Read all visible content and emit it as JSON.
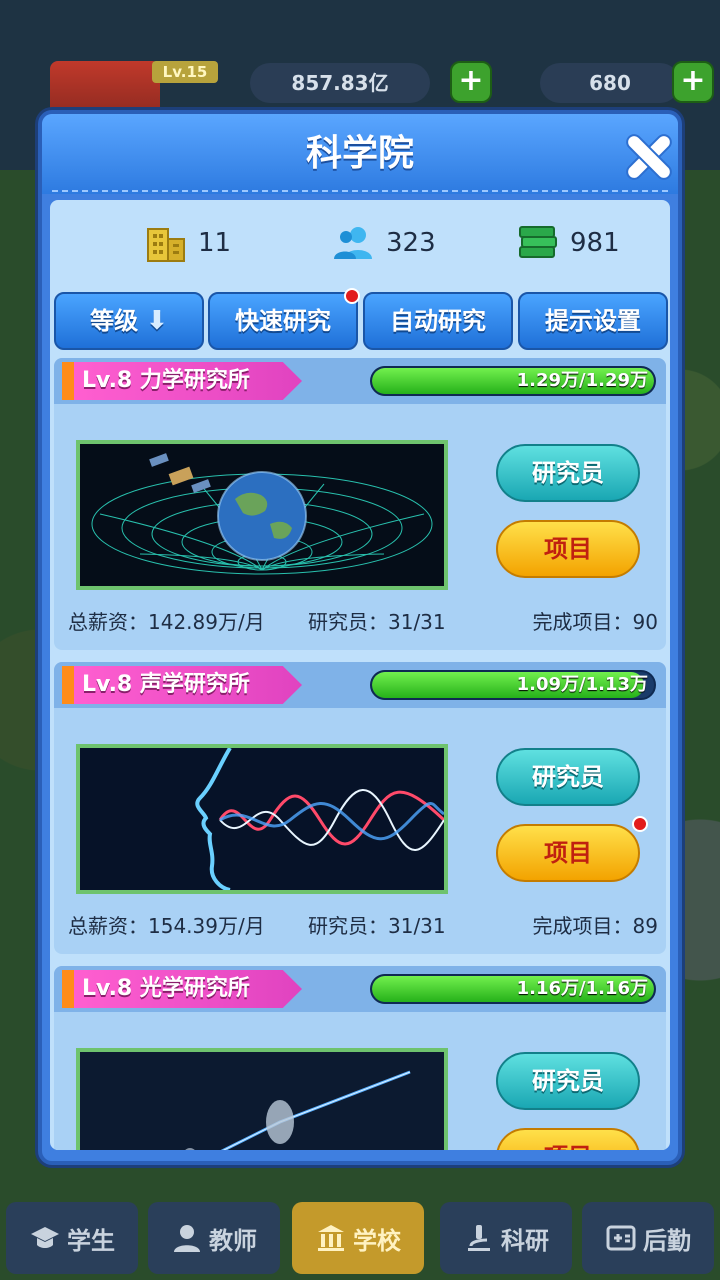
{
  "topbar": {
    "level": "Lv.15",
    "money": "857.83亿",
    "gems": "680",
    "plus": "+"
  },
  "dialog": {
    "title": "科学院",
    "stats": {
      "buildings": "11",
      "researchers": "323",
      "books": "981"
    },
    "tabs": [
      {
        "label": "等级"
      },
      {
        "label": "快速研究"
      },
      {
        "label": "自动研究"
      },
      {
        "label": "提示设置"
      }
    ],
    "tab_arrow": "⬇",
    "institutes": [
      {
        "level_name": "Lv.8 力学研究所",
        "progress_text": "1.29万/1.29万",
        "progress": 1.0,
        "researcher_btn": "研究员",
        "project_btn": "项目",
        "salary": "总薪资：142.89万/月",
        "staff": "研究员：31/31",
        "done": "完成项目：90"
      },
      {
        "level_name": "Lv.8 声学研究所",
        "progress_text": "1.09万/1.13万",
        "progress": 0.965,
        "researcher_btn": "研究员",
        "project_btn": "项目",
        "salary": "总薪资：154.39万/月",
        "staff": "研究员：31/31",
        "done": "完成项目：89"
      },
      {
        "level_name": "Lv.8 光学研究所",
        "progress_text": "1.16万/1.16万",
        "progress": 1.0,
        "researcher_btn": "研究员",
        "project_btn": "项目"
      }
    ]
  },
  "bottom_nav": [
    {
      "label": "学生"
    },
    {
      "label": "教师"
    },
    {
      "label": "学校"
    },
    {
      "label": "科研"
    },
    {
      "label": "后勤"
    }
  ],
  "colors": {
    "accent": "#3f7fe0",
    "progress": "#26b11a",
    "highlight_tab": "#c49a2b"
  }
}
